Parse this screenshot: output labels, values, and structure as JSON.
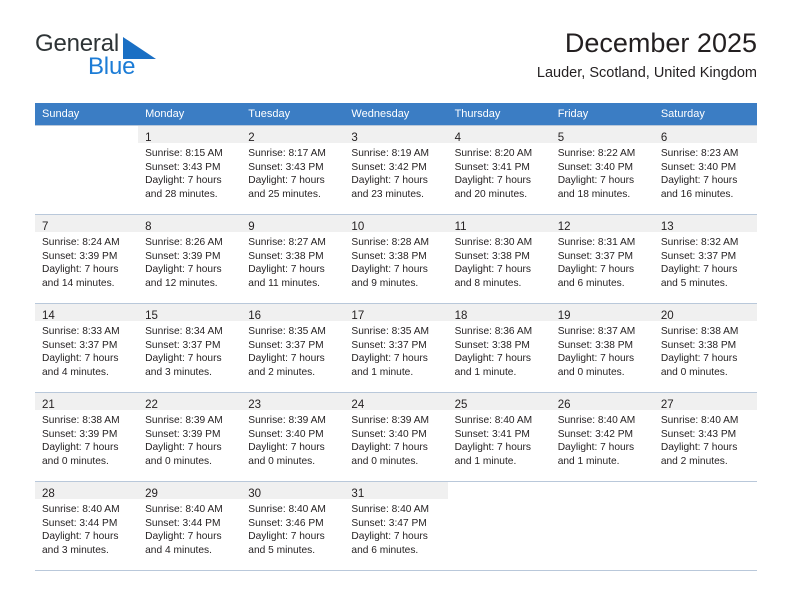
{
  "logo": {
    "word_top": "General",
    "word_bottom": "Blue",
    "triangle_color": "#1a6fc4",
    "blue_color": "#1c7cd6"
  },
  "header": {
    "title": "December 2025",
    "subtitle": "Lauder, Scotland, United Kingdom"
  },
  "theme": {
    "header_row_bg": "#3b7dc4",
    "daynum_bg": "#f0f0f0",
    "grid_border": "#b9c8da",
    "text": "#231f20"
  },
  "weekdays": [
    "Sunday",
    "Monday",
    "Tuesday",
    "Wednesday",
    "Thursday",
    "Friday",
    "Saturday"
  ],
  "weeks": [
    [
      {
        "day": "",
        "sunrise": "",
        "sunset": "",
        "daylight_1": "",
        "daylight_2": ""
      },
      {
        "day": "1",
        "sunrise": "Sunrise: 8:15 AM",
        "sunset": "Sunset: 3:43 PM",
        "daylight_1": "Daylight: 7 hours",
        "daylight_2": "and 28 minutes."
      },
      {
        "day": "2",
        "sunrise": "Sunrise: 8:17 AM",
        "sunset": "Sunset: 3:43 PM",
        "daylight_1": "Daylight: 7 hours",
        "daylight_2": "and 25 minutes."
      },
      {
        "day": "3",
        "sunrise": "Sunrise: 8:19 AM",
        "sunset": "Sunset: 3:42 PM",
        "daylight_1": "Daylight: 7 hours",
        "daylight_2": "and 23 minutes."
      },
      {
        "day": "4",
        "sunrise": "Sunrise: 8:20 AM",
        "sunset": "Sunset: 3:41 PM",
        "daylight_1": "Daylight: 7 hours",
        "daylight_2": "and 20 minutes."
      },
      {
        "day": "5",
        "sunrise": "Sunrise: 8:22 AM",
        "sunset": "Sunset: 3:40 PM",
        "daylight_1": "Daylight: 7 hours",
        "daylight_2": "and 18 minutes."
      },
      {
        "day": "6",
        "sunrise": "Sunrise: 8:23 AM",
        "sunset": "Sunset: 3:40 PM",
        "daylight_1": "Daylight: 7 hours",
        "daylight_2": "and 16 minutes."
      }
    ],
    [
      {
        "day": "7",
        "sunrise": "Sunrise: 8:24 AM",
        "sunset": "Sunset: 3:39 PM",
        "daylight_1": "Daylight: 7 hours",
        "daylight_2": "and 14 minutes."
      },
      {
        "day": "8",
        "sunrise": "Sunrise: 8:26 AM",
        "sunset": "Sunset: 3:39 PM",
        "daylight_1": "Daylight: 7 hours",
        "daylight_2": "and 12 minutes."
      },
      {
        "day": "9",
        "sunrise": "Sunrise: 8:27 AM",
        "sunset": "Sunset: 3:38 PM",
        "daylight_1": "Daylight: 7 hours",
        "daylight_2": "and 11 minutes."
      },
      {
        "day": "10",
        "sunrise": "Sunrise: 8:28 AM",
        "sunset": "Sunset: 3:38 PM",
        "daylight_1": "Daylight: 7 hours",
        "daylight_2": "and 9 minutes."
      },
      {
        "day": "11",
        "sunrise": "Sunrise: 8:30 AM",
        "sunset": "Sunset: 3:38 PM",
        "daylight_1": "Daylight: 7 hours",
        "daylight_2": "and 8 minutes."
      },
      {
        "day": "12",
        "sunrise": "Sunrise: 8:31 AM",
        "sunset": "Sunset: 3:37 PM",
        "daylight_1": "Daylight: 7 hours",
        "daylight_2": "and 6 minutes."
      },
      {
        "day": "13",
        "sunrise": "Sunrise: 8:32 AM",
        "sunset": "Sunset: 3:37 PM",
        "daylight_1": "Daylight: 7 hours",
        "daylight_2": "and 5 minutes."
      }
    ],
    [
      {
        "day": "14",
        "sunrise": "Sunrise: 8:33 AM",
        "sunset": "Sunset: 3:37 PM",
        "daylight_1": "Daylight: 7 hours",
        "daylight_2": "and 4 minutes."
      },
      {
        "day": "15",
        "sunrise": "Sunrise: 8:34 AM",
        "sunset": "Sunset: 3:37 PM",
        "daylight_1": "Daylight: 7 hours",
        "daylight_2": "and 3 minutes."
      },
      {
        "day": "16",
        "sunrise": "Sunrise: 8:35 AM",
        "sunset": "Sunset: 3:37 PM",
        "daylight_1": "Daylight: 7 hours",
        "daylight_2": "and 2 minutes."
      },
      {
        "day": "17",
        "sunrise": "Sunrise: 8:35 AM",
        "sunset": "Sunset: 3:37 PM",
        "daylight_1": "Daylight: 7 hours",
        "daylight_2": "and 1 minute."
      },
      {
        "day": "18",
        "sunrise": "Sunrise: 8:36 AM",
        "sunset": "Sunset: 3:38 PM",
        "daylight_1": "Daylight: 7 hours",
        "daylight_2": "and 1 minute."
      },
      {
        "day": "19",
        "sunrise": "Sunrise: 8:37 AM",
        "sunset": "Sunset: 3:38 PM",
        "daylight_1": "Daylight: 7 hours",
        "daylight_2": "and 0 minutes."
      },
      {
        "day": "20",
        "sunrise": "Sunrise: 8:38 AM",
        "sunset": "Sunset: 3:38 PM",
        "daylight_1": "Daylight: 7 hours",
        "daylight_2": "and 0 minutes."
      }
    ],
    [
      {
        "day": "21",
        "sunrise": "Sunrise: 8:38 AM",
        "sunset": "Sunset: 3:39 PM",
        "daylight_1": "Daylight: 7 hours",
        "daylight_2": "and 0 minutes."
      },
      {
        "day": "22",
        "sunrise": "Sunrise: 8:39 AM",
        "sunset": "Sunset: 3:39 PM",
        "daylight_1": "Daylight: 7 hours",
        "daylight_2": "and 0 minutes."
      },
      {
        "day": "23",
        "sunrise": "Sunrise: 8:39 AM",
        "sunset": "Sunset: 3:40 PM",
        "daylight_1": "Daylight: 7 hours",
        "daylight_2": "and 0 minutes."
      },
      {
        "day": "24",
        "sunrise": "Sunrise: 8:39 AM",
        "sunset": "Sunset: 3:40 PM",
        "daylight_1": "Daylight: 7 hours",
        "daylight_2": "and 0 minutes."
      },
      {
        "day": "25",
        "sunrise": "Sunrise: 8:40 AM",
        "sunset": "Sunset: 3:41 PM",
        "daylight_1": "Daylight: 7 hours",
        "daylight_2": "and 1 minute."
      },
      {
        "day": "26",
        "sunrise": "Sunrise: 8:40 AM",
        "sunset": "Sunset: 3:42 PM",
        "daylight_1": "Daylight: 7 hours",
        "daylight_2": "and 1 minute."
      },
      {
        "day": "27",
        "sunrise": "Sunrise: 8:40 AM",
        "sunset": "Sunset: 3:43 PM",
        "daylight_1": "Daylight: 7 hours",
        "daylight_2": "and 2 minutes."
      }
    ],
    [
      {
        "day": "28",
        "sunrise": "Sunrise: 8:40 AM",
        "sunset": "Sunset: 3:44 PM",
        "daylight_1": "Daylight: 7 hours",
        "daylight_2": "and 3 minutes."
      },
      {
        "day": "29",
        "sunrise": "Sunrise: 8:40 AM",
        "sunset": "Sunset: 3:44 PM",
        "daylight_1": "Daylight: 7 hours",
        "daylight_2": "and 4 minutes."
      },
      {
        "day": "30",
        "sunrise": "Sunrise: 8:40 AM",
        "sunset": "Sunset: 3:46 PM",
        "daylight_1": "Daylight: 7 hours",
        "daylight_2": "and 5 minutes."
      },
      {
        "day": "31",
        "sunrise": "Sunrise: 8:40 AM",
        "sunset": "Sunset: 3:47 PM",
        "daylight_1": "Daylight: 7 hours",
        "daylight_2": "and 6 minutes."
      },
      {
        "day": "",
        "sunrise": "",
        "sunset": "",
        "daylight_1": "",
        "daylight_2": ""
      },
      {
        "day": "",
        "sunrise": "",
        "sunset": "",
        "daylight_1": "",
        "daylight_2": ""
      },
      {
        "day": "",
        "sunrise": "",
        "sunset": "",
        "daylight_1": "",
        "daylight_2": ""
      }
    ]
  ]
}
